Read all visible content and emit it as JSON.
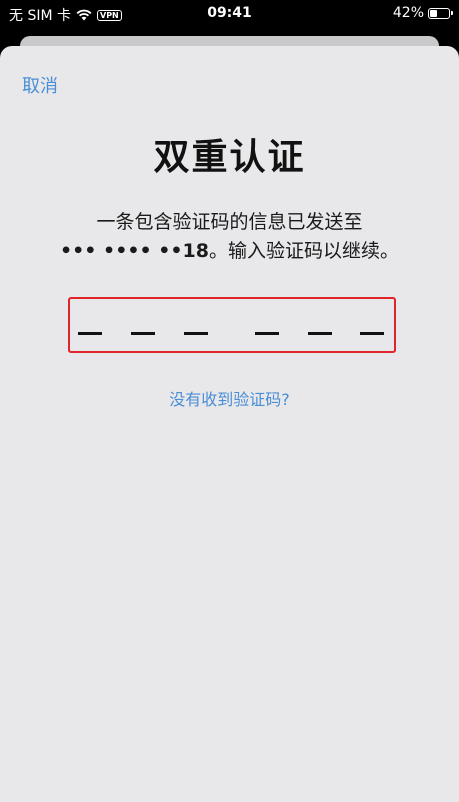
{
  "status_bar": {
    "carrier": "无 SIM 卡",
    "vpn_label": "VPN",
    "time": "09:41",
    "battery_percent": "42%",
    "battery_level": 0.42
  },
  "nav": {
    "cancel_label": "取消"
  },
  "content": {
    "title": "双重认证",
    "message_line1": "一条包含验证码的信息已发送至",
    "phone_masked": "••• •••• ••18",
    "message_line2_suffix": "。输入验证码以继续。",
    "code_slots": 6,
    "resend_label": "没有收到验证码?"
  },
  "colors": {
    "accent": "#4a8ed6",
    "highlight_border": "#e0242a",
    "sheet_background": "#e8e8ea"
  }
}
